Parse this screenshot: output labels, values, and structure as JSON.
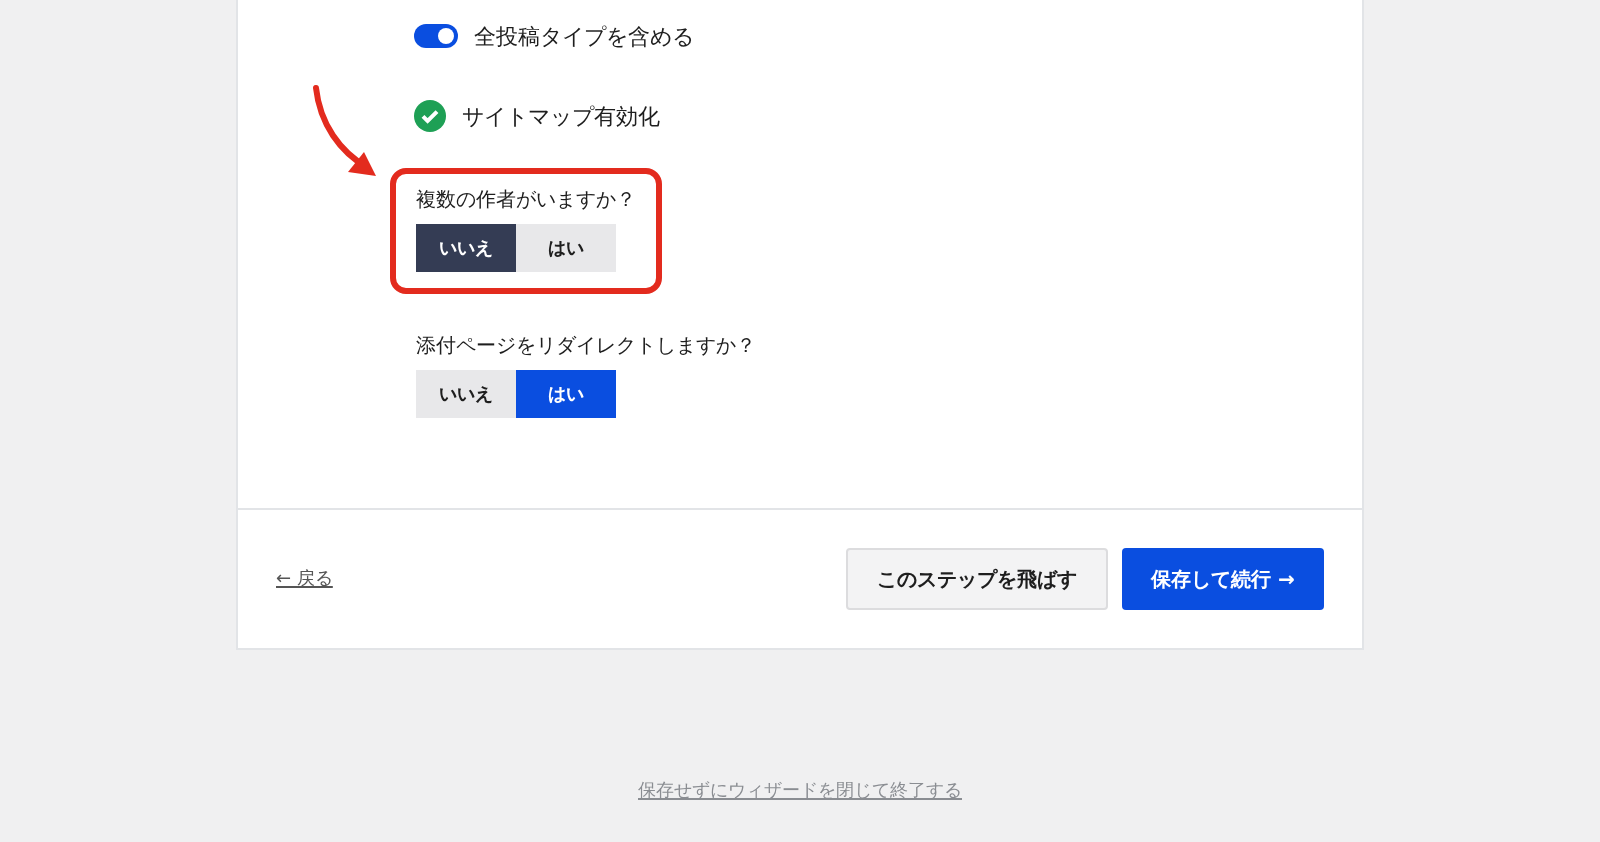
{
  "settings": [
    {
      "kind": "toggle",
      "label": "全投稿タイプを含める",
      "on": true
    },
    {
      "kind": "check",
      "label": "サイトマップ有効化",
      "checked": true
    }
  ],
  "questions": [
    {
      "label": "複数の作者がいますか？",
      "highlighted": true,
      "options": [
        {
          "label": "いいえ",
          "selected": true
        },
        {
          "label": "はい",
          "selected": false
        }
      ]
    },
    {
      "label": "添付ページをリダイレクトしますか？",
      "highlighted": false,
      "options": [
        {
          "label": "いいえ",
          "selected": false
        },
        {
          "label": "はい",
          "selected": true
        }
      ]
    }
  ],
  "footer": {
    "back": "← 戻る",
    "skip": "このステップを飛ばす",
    "save": "保存して続行 →"
  },
  "exit_link": "保存せずにウィザードを閉じて終了する"
}
